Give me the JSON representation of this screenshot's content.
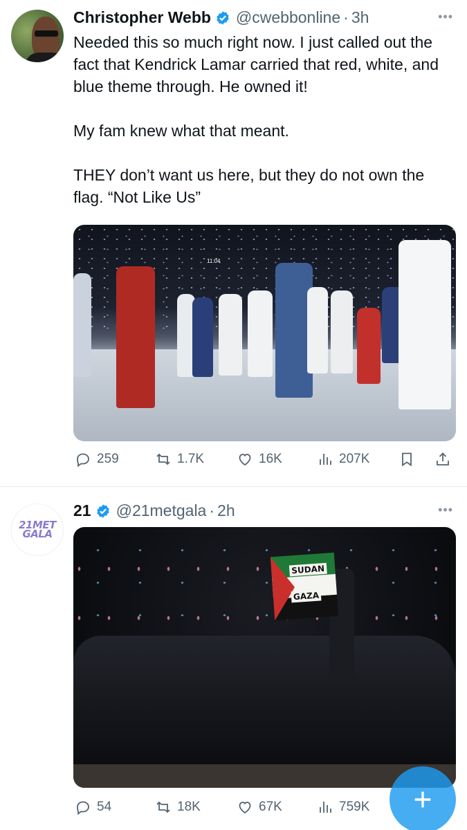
{
  "colors": {
    "accent": "#1d9bf0",
    "muted": "#536471",
    "text": "#0f1419"
  },
  "tweets": [
    {
      "author": {
        "name": "Christopher Webb",
        "handle": "@cwebbonline",
        "time": "3h"
      },
      "text": [
        "Needed this so much right now. I just called out the fact that Kendrick Lamar carried that red, white, and blue theme through. He owned it!",
        "My fam knew what that meant.",
        "THEY don’t want us here, but they do not own the flag. “Not Like Us”"
      ],
      "media": {
        "clock": "11:04"
      },
      "stats": {
        "replies": "259",
        "reposts": "1.7K",
        "likes": "16K",
        "views": "207K"
      }
    },
    {
      "author": {
        "name": "21",
        "handle": "@21metgala",
        "time": "2h",
        "avatar_logo": [
          "21MET",
          "GALA"
        ]
      },
      "media": {
        "flag_labels": [
          "SUDAN",
          "GAZA"
        ]
      },
      "stats": {
        "replies": "54",
        "reposts": "18K",
        "likes": "67K",
        "views": "759K"
      }
    }
  ],
  "icons": [
    "more-icon",
    "verified-icon",
    "reply-icon",
    "repost-icon",
    "like-icon",
    "views-icon",
    "bookmark-icon",
    "share-icon",
    "compose-plus-icon"
  ]
}
